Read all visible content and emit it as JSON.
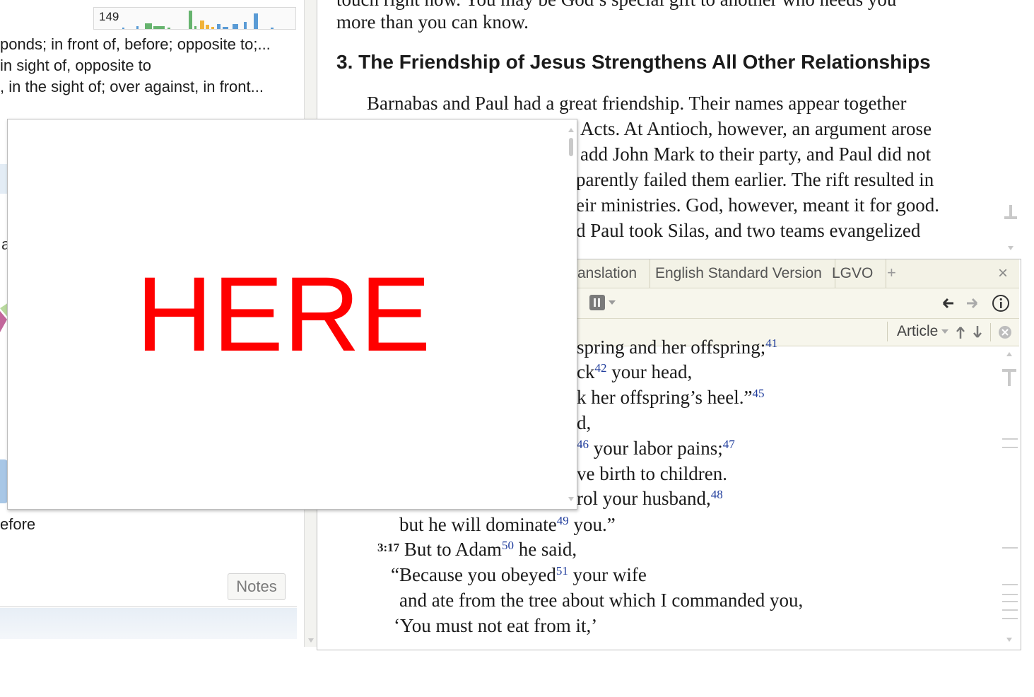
{
  "left_panel": {
    "frequency_count": "149",
    "definitions": [
      "ponds; in front of, before; opposite to;...",
      "in sight of, opposite to",
      ", in the sight of; over against, in front..."
    ],
    "partial_label_before": "efore",
    "partial_char": "a",
    "notes_button": "Notes"
  },
  "top_panel": {
    "cut_line": "touch right now. You may be God’s special gift to another who needs you",
    "line2": "more than you can know.",
    "heading": "3. The Friendship of Jesus Strengthens All Other Relationships",
    "paragraph": [
      "Barnabas and Paul had a great friendship. Their names appear together",
      "Acts. At Antioch, however, an argument arose",
      "add John Mark to their party, and Paul did not",
      "parently failed them earlier. The rift resulted in",
      "eir ministries. God, however, meant it for good.",
      "d Paul took Silas, and two teams evangelized"
    ]
  },
  "bottom_panel": {
    "tabs": [
      "anslation",
      "English Standard Version",
      "LGVO"
    ],
    "add_tab": "+",
    "close": "×",
    "article_label": "Article",
    "verses": {
      "l1_text": "spring and her offspring;",
      "l1_fn": "41",
      "l2_a": "ck",
      "l2_fn": "42",
      "l2_b": " your head,",
      "l3_a": "k her offspring’s heel.”",
      "l3_fn": "45",
      "l4": "d,",
      "l5_fn": "46",
      "l5_b": " your labor pains;",
      "l5_fn2": "47",
      "l6": "ve birth to children.",
      "l7_a": "rol your husband,",
      "l7_fn": "48",
      "l8_a": "but he will dominate",
      "l8_fn": "49",
      "l8_b": " you.”",
      "l9_num": "3:17",
      "l9_a": " But to Adam",
      "l9_fn": "50",
      "l9_b": " he said,",
      "l10_a": "“Because you obeyed",
      "l10_fn": "51",
      "l10_b": " your wife",
      "l11": "and ate from the tree about which I commanded you,",
      "l12": "‘You must not eat from it,’"
    }
  },
  "popup": {
    "placeholder": "HERE"
  },
  "colors": {
    "placeholder_text": "#ff0000",
    "footnote": "#1f3c9c",
    "tabbar_bg": "#f3f2e6"
  }
}
